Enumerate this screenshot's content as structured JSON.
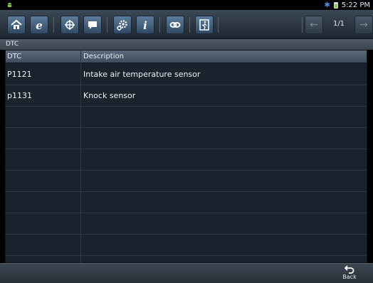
{
  "status": {
    "time": "5:22 PM"
  },
  "toolbar": {
    "buttons": [
      "home-icon",
      "browser-icon",
      "vehicle-icon",
      "message-icon",
      "settings-icon",
      "info-icon",
      "link-icon",
      "exit-icon"
    ],
    "pager": {
      "count": "1/1"
    }
  },
  "section": {
    "title": "DTC"
  },
  "table": {
    "headers": {
      "code": "DTC",
      "description": "Description"
    },
    "rows": [
      {
        "code": "P1121",
        "description": "Intake air temperature sensor"
      },
      {
        "code": "p1131",
        "description": "Knock sensor"
      }
    ]
  },
  "footer": {
    "back_label": "Back"
  }
}
